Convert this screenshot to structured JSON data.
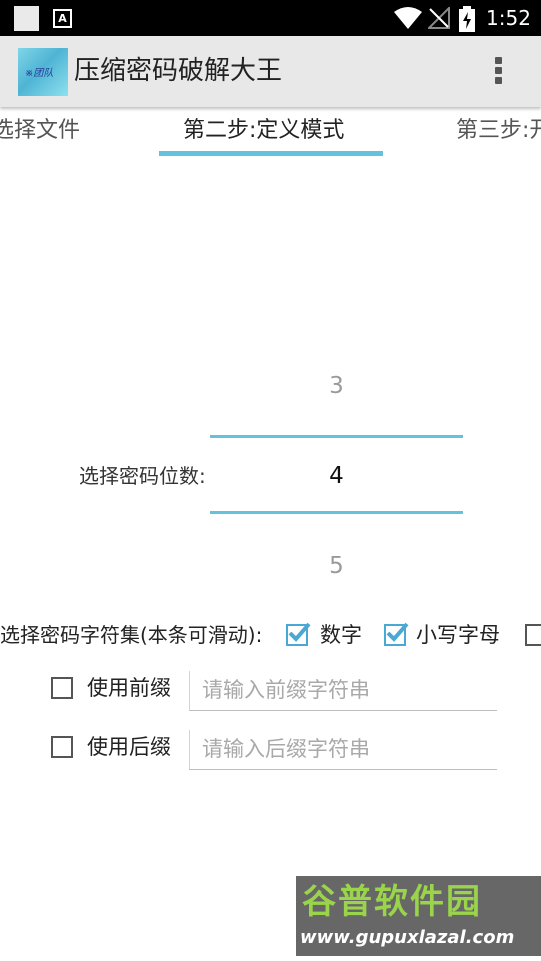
{
  "status_bar": {
    "time": "1:52",
    "notification_icons": [
      "blank-square-icon",
      "text-a-icon"
    ],
    "system_icons": [
      "wifi-icon",
      "no-signal-icon",
      "battery-charging-icon"
    ]
  },
  "app_bar": {
    "title": "压缩密码破解大王",
    "logo_text": "※团队",
    "overflow_icon": "overflow-menu-icon"
  },
  "tabs": [
    {
      "label": "选择文件",
      "selected": false
    },
    {
      "label": "第二步:定义模式",
      "selected": true
    },
    {
      "label": "第三步:开",
      "selected": false
    }
  ],
  "digits_picker": {
    "label": "选择密码位数:",
    "previous": "3",
    "current": "4",
    "next": "5"
  },
  "charset": {
    "label": "选择密码字符集(本条可滑动):",
    "options": [
      {
        "label": "数字",
        "checked": true
      },
      {
        "label": "小写字母",
        "checked": true
      },
      {
        "label": "",
        "checked": false
      }
    ]
  },
  "prefix": {
    "label": "使用前缀",
    "checked": false,
    "value": "",
    "placeholder": "请输入前缀字符串"
  },
  "suffix": {
    "label": "使用后缀",
    "checked": false,
    "value": "",
    "placeholder": "请输入后缀字符串"
  },
  "watermark": {
    "title": "谷普软件园",
    "url": "www.gupuxlazal.com"
  },
  "colors": {
    "accent": "#63c3dd",
    "checkbox_checked": "#4aa8d4",
    "status_bar": "#000000",
    "app_bar": "#e8e8e8",
    "watermark_green": "#9ad44a"
  }
}
